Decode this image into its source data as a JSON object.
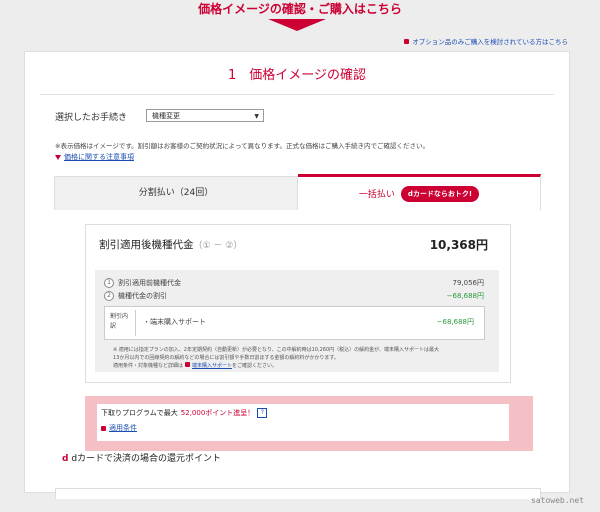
{
  "header": {
    "title": "価格イメージの確認・ご購入はこちら",
    "option_link": "オプション品のみご購入を検討されている方はこちら"
  },
  "section": {
    "title": "1　価格イメージの確認",
    "procedure_label": "選択したお手続き",
    "procedure_value": "機種変更",
    "note": "※表示価格はイメージです。割引額はお客様のご契約状況によって異なります。正式な価格はご購入手続き内でご確認ください。",
    "notice_link": "価格に関する注意事項"
  },
  "tabs": {
    "installment": "分割払い（24回）",
    "lump_sum": "一括払い",
    "dcard_badge": "dカードならおトク!"
  },
  "price": {
    "title": "割引適用後機種代金",
    "title_suffix": "（① － ②）",
    "total": "10,368円",
    "rows": [
      {
        "num": "1",
        "label": "割引適用前機種代金",
        "value": "79,056円"
      },
      {
        "num": "2",
        "label": "機種代金の割引",
        "value": "−68,688円"
      }
    ],
    "breakdown_label": "割引内訳",
    "breakdown_item": "・端末購入サポート",
    "breakdown_value": "−68,688円",
    "fine_print_1": "※ 適用には指定プランの加入、2年定期契約（自動更新）が必要となり、この中解約時は10,260円（税込）の解約金が、端末購入サポートは最大",
    "fine_print_2": "13か月以内での回線契約の解約などの場合には割引額や手数日割ほする金額の解約料がかかります。",
    "fine_print_3": "適用条件・対象機種など詳細は",
    "fine_print_link": "端末購入サポート",
    "fine_print_4": "をご確認ください。"
  },
  "promo": {
    "text_before": "下取りプログラムで最大",
    "points": "52,000ポイント進呈！",
    "help": "?",
    "link": "適用条件"
  },
  "bottom": {
    "logo": "d",
    "text": "dカードで決済の場合の還元ポイント"
  },
  "watermark": "satoweb.net"
}
